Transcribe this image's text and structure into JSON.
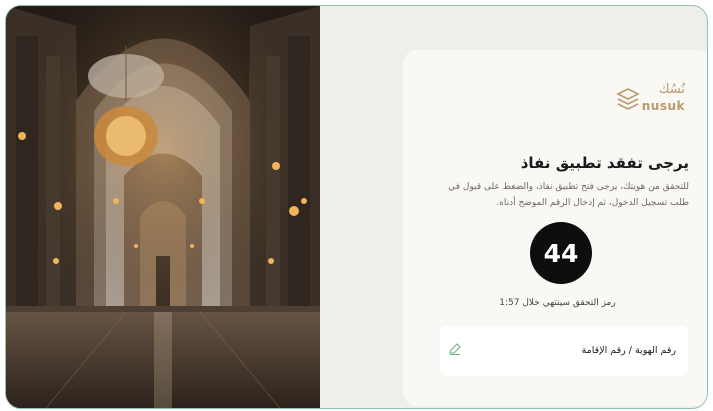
{
  "brand": {
    "logo_text": "nusuk",
    "logo_arabic": "نُسُك",
    "accent": "#b99a6e"
  },
  "auth": {
    "title": "يرجى تفقد تطبيق نفاذ",
    "description": "للتحقق من هويتك، يرجى فتح تطبيق نفاذ، والضغط على قبول في طلب تسجيل الدخول، ثم إدخال الرقم الموضح أدناه.",
    "code": "44",
    "timer_text": "رمز التحقق سينتهي خلال 1:57",
    "id_field_label": "رقم الهوية / رقم الإقامة"
  },
  "icons": {
    "edit": "pencil-icon"
  }
}
